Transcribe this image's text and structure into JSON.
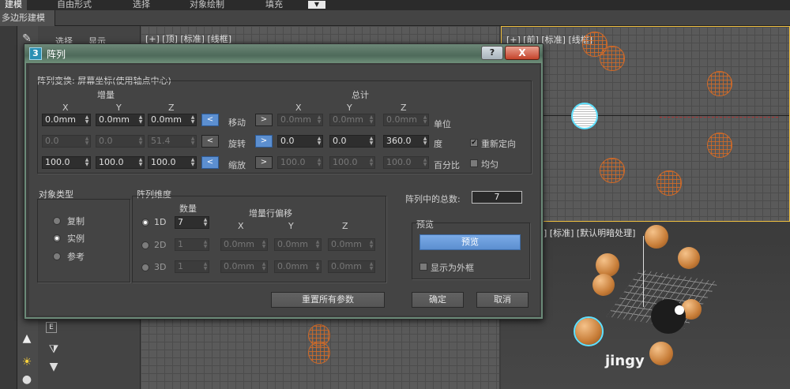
{
  "menubar": {
    "tabs": [
      {
        "label": "建模",
        "active": true
      },
      {
        "label": "自由形式"
      },
      {
        "label": "选择"
      },
      {
        "label": "对象绘制"
      },
      {
        "label": "填充"
      }
    ],
    "ribbon_title": "多边形建模"
  },
  "command_panel": {
    "tabs": [
      "选择",
      "显示"
    ]
  },
  "viewports": {
    "top_left_label": "[+] [顶] [标准] [线框]",
    "top_right_label": "[+] [前] [标准] [线框]",
    "perspective_label": "] [标准] [默认明暗处理]",
    "watermark": "jingy"
  },
  "dialog": {
    "icon": "3",
    "title": "阵列",
    "help": "?",
    "close": "X",
    "transform": {
      "group_label": "阵列变换: 屏幕坐标(使用轴点中心)",
      "increment_label": "增量",
      "totals_label": "总计",
      "axes": [
        "X",
        "Y",
        "Z"
      ],
      "rows": [
        {
          "name": "移动",
          "unit": "单位",
          "increment": [
            "0.0mm",
            "0.0mm",
            "0.0mm"
          ],
          "totals": [
            "0.0mm",
            "0.0mm",
            "0.0mm"
          ],
          "increment_disabled": false,
          "totals_disabled": true,
          "left_arrow": "<",
          "right_arrow": ">",
          "left_on": true,
          "right_on": false
        },
        {
          "name": "旋转",
          "unit": "度",
          "increment": [
            "0.0",
            "0.0",
            "51.4"
          ],
          "totals": [
            "0.0",
            "0.0",
            "360.0"
          ],
          "increment_disabled": true,
          "totals_disabled": false,
          "left_arrow": "<",
          "right_arrow": ">",
          "left_on": false,
          "right_on": true
        },
        {
          "name": "缩放",
          "unit": "百分比",
          "increment": [
            "100.0",
            "100.0",
            "100.0"
          ],
          "totals": [
            "100.0",
            "100.0",
            "100.0"
          ],
          "increment_disabled": false,
          "totals_disabled": true,
          "left_arrow": "<",
          "right_arrow": ">",
          "left_on": true,
          "right_on": false
        }
      ],
      "reorient": {
        "label": "重新定向",
        "checked": true
      },
      "uniform": {
        "label": "均匀",
        "checked": false
      }
    },
    "object_type": {
      "group_label": "对象类型",
      "options": [
        {
          "label": "复制",
          "checked": false
        },
        {
          "label": "实例",
          "checked": true
        },
        {
          "label": "参考",
          "checked": false
        }
      ]
    },
    "dimensions": {
      "group_label": "阵列维度",
      "count_label": "数量",
      "row_offset_label": "增量行偏移",
      "axes": [
        "X",
        "Y",
        "Z"
      ],
      "rows": [
        {
          "label": "1D",
          "checked": true,
          "count": "7",
          "offsets": [],
          "disabled": false
        },
        {
          "label": "2D",
          "checked": false,
          "count": "1",
          "offsets": [
            "0.0mm",
            "0.0mm",
            "0.0mm"
          ],
          "disabled": true
        },
        {
          "label": "3D",
          "checked": false,
          "count": "1",
          "offsets": [
            "0.0mm",
            "0.0mm",
            "0.0mm"
          ],
          "disabled": true
        }
      ]
    },
    "total": {
      "label": "阵列中的总数:",
      "value": "7"
    },
    "preview": {
      "group_label": "预览",
      "button": "预览",
      "show_box": {
        "label": "显示为外框",
        "checked": false
      }
    },
    "buttons": {
      "reset": "重置所有参数",
      "ok": "确定",
      "cancel": "取消"
    }
  }
}
